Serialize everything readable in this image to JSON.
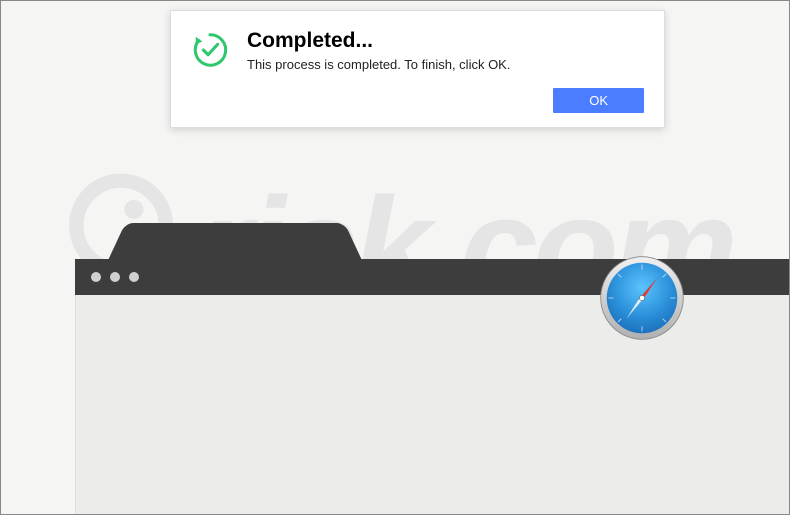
{
  "dialog": {
    "title": "Completed...",
    "message": "This process is completed. To finish, click OK.",
    "ok_label": "OK"
  },
  "watermark": {
    "text": "risk.com"
  },
  "colors": {
    "accent": "#4a7dff",
    "success": "#2dc76d",
    "browser_chrome": "#3d3d3d"
  },
  "icons": {
    "dialog_icon": "checkmark-refresh-icon",
    "app_icon": "safari-compass-icon"
  }
}
